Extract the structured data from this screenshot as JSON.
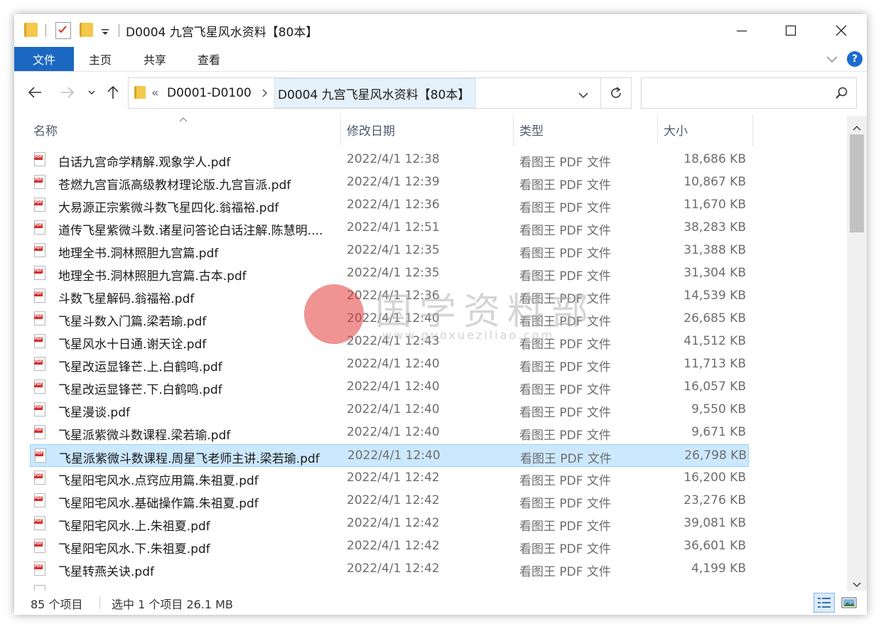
{
  "window": {
    "title": "D0004 九宫飞星风水资料【80本】"
  },
  "ribbon": {
    "tabs": [
      "文件",
      "主页",
      "共享",
      "查看"
    ],
    "help_label": "?"
  },
  "address": {
    "overflow_glyph": "«",
    "crumbs": [
      "D0001-D0100",
      "D0004 九宫飞星风水资料【80本】"
    ],
    "search_placeholder": ""
  },
  "columns": {
    "name": "名称",
    "date": "修改日期",
    "type": "类型",
    "size": "大小"
  },
  "files": [
    {
      "name": "白话九宫命学精解.观象学人.pdf",
      "date": "2022/4/1 12:38",
      "type": "看图王 PDF 文件",
      "size": "18,686 KB"
    },
    {
      "name": "苍燃九宫盲派高级教材理论版.九宫盲派.pdf",
      "date": "2022/4/1 12:39",
      "type": "看图王 PDF 文件",
      "size": "10,867 KB"
    },
    {
      "name": "大易源正宗紫微斗数飞星四化.翁福裕.pdf",
      "date": "2022/4/1 12:36",
      "type": "看图王 PDF 文件",
      "size": "11,670 KB"
    },
    {
      "name": "道传飞星紫微斗数.诸星问答论白话注解.陈慧明....",
      "date": "2022/4/1 12:51",
      "type": "看图王 PDF 文件",
      "size": "38,283 KB"
    },
    {
      "name": "地理全书.洞林照胆九宫篇.pdf",
      "date": "2022/4/1 12:35",
      "type": "看图王 PDF 文件",
      "size": "31,388 KB"
    },
    {
      "name": "地理全书.洞林照胆九宫篇.古本.pdf",
      "date": "2022/4/1 12:35",
      "type": "看图王 PDF 文件",
      "size": "31,304 KB"
    },
    {
      "name": "斗数飞星解码.翁福裕.pdf",
      "date": "2022/4/1 12:36",
      "type": "看图王 PDF 文件",
      "size": "14,539 KB"
    },
    {
      "name": "飞星斗数入门篇.梁若瑜.pdf",
      "date": "2022/4/1 12:40",
      "type": "看图王 PDF 文件",
      "size": "26,685 KB"
    },
    {
      "name": "飞星风水十日通.谢天诠.pdf",
      "date": "2022/4/1 12:43",
      "type": "看图王 PDF 文件",
      "size": "41,512 KB"
    },
    {
      "name": "飞星改运显锋芒.上.白鹤鸣.pdf",
      "date": "2022/4/1 12:40",
      "type": "看图王 PDF 文件",
      "size": "11,713 KB"
    },
    {
      "name": "飞星改运显锋芒.下.白鹤鸣.pdf",
      "date": "2022/4/1 12:40",
      "type": "看图王 PDF 文件",
      "size": "16,057 KB"
    },
    {
      "name": "飞星漫谈.pdf",
      "date": "2022/4/1 12:40",
      "type": "看图王 PDF 文件",
      "size": "9,550 KB"
    },
    {
      "name": "飞星派紫微斗数课程.梁若瑜.pdf",
      "date": "2022/4/1 12:40",
      "type": "看图王 PDF 文件",
      "size": "9,671 KB"
    },
    {
      "name": "飞星派紫微斗数课程.周星飞老师主讲.梁若瑜.pdf",
      "date": "2022/4/1 12:40",
      "type": "看图王 PDF 文件",
      "size": "26,798 KB",
      "selected": true
    },
    {
      "name": "飞星阳宅风水.点窍应用篇.朱祖夏.pdf",
      "date": "2022/4/1 12:42",
      "type": "看图王 PDF 文件",
      "size": "16,200 KB"
    },
    {
      "name": "飞星阳宅风水.基础操作篇.朱祖夏.pdf",
      "date": "2022/4/1 12:42",
      "type": "看图王 PDF 文件",
      "size": "23,276 KB"
    },
    {
      "name": "飞星阳宅风水.上.朱祖夏.pdf",
      "date": "2022/4/1 12:42",
      "type": "看图王 PDF 文件",
      "size": "39,081 KB"
    },
    {
      "name": "飞星阳宅风水.下.朱祖夏.pdf",
      "date": "2022/4/1 12:42",
      "type": "看图王 PDF 文件",
      "size": "36,601 KB"
    },
    {
      "name": "飞星转燕关诀.pdf",
      "date": "2022/4/1 12:42",
      "type": "看图王 PDF 文件",
      "size": "4,199 KB"
    }
  ],
  "status": {
    "count": "85 个项目",
    "selection": "选中 1 个项目  26.1 MB"
  },
  "watermark": {
    "text": "国学资料部",
    "url": "www.guoxueziliao.com"
  },
  "colors": {
    "accent": "#1b68c2",
    "selection_bg": "#cce8ff",
    "selection_border": "#99d1ff",
    "crumb_highlight": "#e5f1fb"
  },
  "icons": [
    "folder-icon",
    "properties-icon",
    "dropdown-icon",
    "minimize-icon",
    "maximize-icon",
    "close-icon",
    "chevron-down-icon",
    "help-icon",
    "back-arrow-icon",
    "forward-arrow-icon",
    "recent-dropdown-icon",
    "up-arrow-icon",
    "refresh-icon",
    "search-icon",
    "pdf-file-icon",
    "details-view-icon",
    "large-icons-view-icon"
  ]
}
